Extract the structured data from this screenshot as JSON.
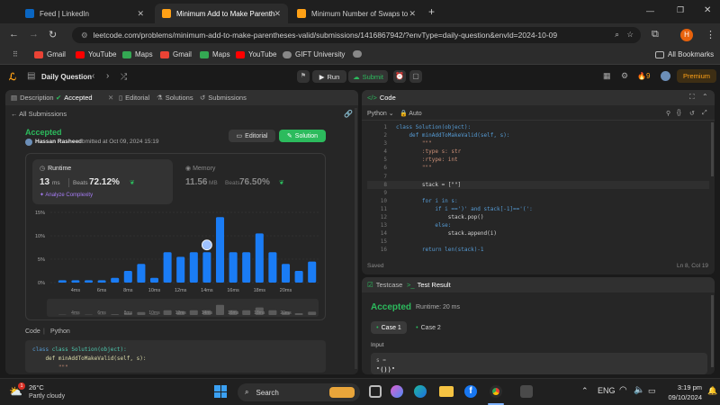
{
  "browser": {
    "tabs": [
      {
        "title": "Feed | LinkedIn",
        "active": false
      },
      {
        "title": "Minimum Add to Make Parenth",
        "active": true
      },
      {
        "title": "Minimum Number of Swaps to",
        "active": false
      }
    ],
    "url": "leetcode.com/problems/minimum-add-to-make-parentheses-valid/submissions/1416867942/?envType=daily-question&envId=2024-10-09",
    "profile_initial": "H",
    "bookmarks": [
      "Gmail",
      "YouTube",
      "Maps",
      "Gmail",
      "Maps",
      "YouTube",
      "GIFT University"
    ],
    "all_bookmarks": "All Bookmarks"
  },
  "lc": {
    "daily": "Daily Question",
    "run": "Run",
    "submit": "Submit",
    "streak": "9",
    "premium": "Premium"
  },
  "left": {
    "tabs": [
      "Description",
      "Accepted",
      "Editorial",
      "Solutions",
      "Submissions"
    ],
    "all_submissions": "All Submissions",
    "status": "Accepted",
    "user": "Hassan Rasheed",
    "submitted_at": "submitted at Oct 09, 2024 15:19",
    "editorial_btn": "Editorial",
    "solution_btn": "Solution",
    "runtime_label": "Runtime",
    "runtime_value": "13",
    "runtime_unit": "ms",
    "beats_label": "Beats",
    "runtime_beats": "72.12%",
    "analyze": "Analyze Complexity",
    "memory_label": "Memory",
    "memory_value": "11.56",
    "memory_unit": "MB",
    "memory_beats": "76.50%",
    "code_label": "Code",
    "lang_label": "Python",
    "code_preview": [
      "class Solution(object):",
      "    def minAddToMakeValid(self, s):",
      "        \"\"\""
    ]
  },
  "chart_data": {
    "type": "bar",
    "yticks": [
      "15%",
      "10%",
      "5%",
      "0%"
    ],
    "ylim": [
      0,
      15
    ],
    "xticks": [
      "4ms",
      "6ms",
      "8ms",
      "10ms",
      "12ms",
      "14ms",
      "16ms",
      "18ms",
      "20ms"
    ],
    "values": [
      0.5,
      0.5,
      0.5,
      0.5,
      1,
      2.5,
      4,
      1,
      6.5,
      5.5,
      6.5,
      6.5,
      14,
      6.5,
      6.5,
      10.5,
      6.5,
      4,
      2.5,
      4.5
    ],
    "highlight_index": 12,
    "bar_color": "#1a7cf5"
  },
  "editor": {
    "title": "Code",
    "lang": "Python",
    "mode": "Auto",
    "lines": [
      "class Solution(object):",
      "    def minAddToMakeValid(self, s):",
      "        \"\"\"",
      "        :type s: str",
      "        :rtype: int",
      "        \"\"\"",
      "",
      "        stack = [\"\"]",
      "",
      "        for i in s:",
      "            if i ==')' and stack[-1]=='(':",
      "                stack.pop()",
      "            else:",
      "                stack.append(i)",
      "",
      "        return len(stack)-1"
    ],
    "saved": "Saved",
    "cursor": "Ln 8, Col 19"
  },
  "result": {
    "tab_testcase": "Testcase",
    "tab_result": "Test Result",
    "status": "Accepted",
    "runtime": "Runtime: 20 ms",
    "cases": [
      "Case 1",
      "Case 2"
    ],
    "input_label": "Input",
    "var": "s =",
    "value": "\"())\""
  },
  "taskbar": {
    "temp": "26°C",
    "weather": "Partly cloudy",
    "search": "Search",
    "time": "3:19 pm",
    "date": "09/10/2024",
    "notif": "1"
  },
  "colors": {
    "accent_green": "#2cbb5d",
    "accent_blue": "#1a7cf5",
    "orange": "#ffa116"
  }
}
